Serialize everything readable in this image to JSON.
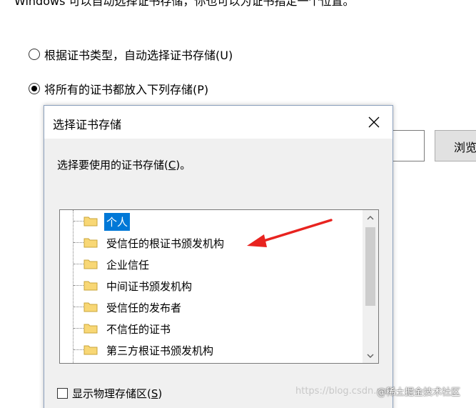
{
  "top_text": "Windows 可以自动选择证书存储，你也可以为证书指定一个位置。",
  "options": {
    "auto": "根据证书类型，自动选择证书存储(U)",
    "manual": "将所有的证书都放入下列存储(P)"
  },
  "background": {
    "browse_label": "浏览"
  },
  "dialog": {
    "title": "选择证书存储",
    "prompt_prefix": "选择要使用的证书存储(",
    "prompt_key": "C",
    "prompt_suffix": ")。",
    "tree_items": [
      "个人",
      "受信任的根证书颁发机构",
      "企业信任",
      "中间证书颁发机构",
      "受信任的发布者",
      "不信任的证书",
      "第三方根证书颁发机构"
    ],
    "show_physical_prefix": "显示物理存储区(",
    "show_physical_key": "S",
    "show_physical_suffix": ")"
  },
  "watermark": {
    "url": "https://blog.csdn.net/...",
    "brand": "@稀土掘金技术社区"
  },
  "colors": {
    "selection": "#0078d7",
    "arrow": "#e8231f",
    "folder": "#f8d775"
  }
}
